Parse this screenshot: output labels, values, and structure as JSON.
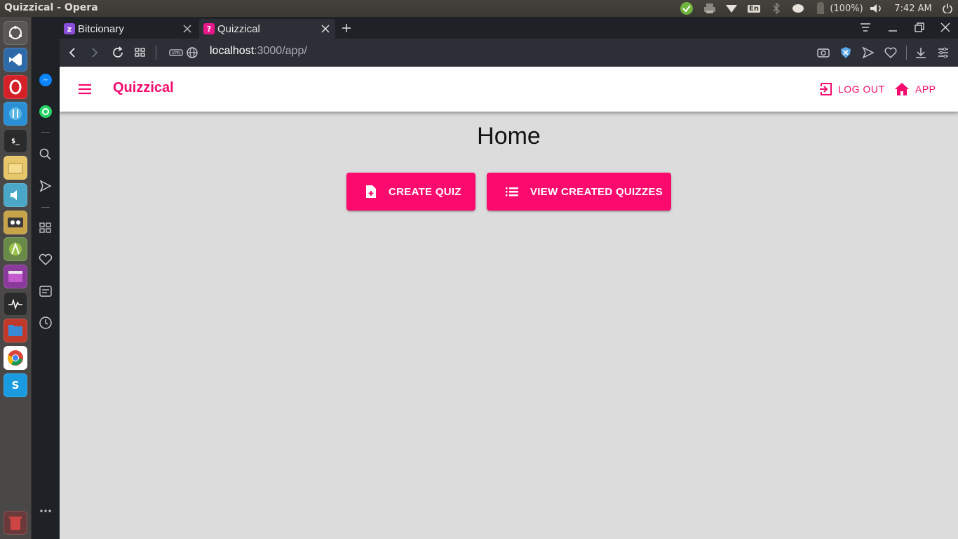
{
  "os": {
    "window_title": "Quizzical - Opera",
    "battery": "(100%)",
    "clock": "7:42 AM",
    "keyboard": "En"
  },
  "browser": {
    "tabs": [
      {
        "title": "Bitcionary",
        "favicon_color": "#8a4fd8",
        "favicon_text": "z"
      },
      {
        "title": "Quizzical",
        "favicon_color": "#e8178a",
        "favicon_text": "?"
      }
    ],
    "url": {
      "host": "localhost",
      "rest": ":3000/app/"
    },
    "accent": "#f50a6d"
  },
  "app": {
    "brand": "Quizzical",
    "nav": {
      "logout_label": "LOG OUT",
      "app_label": "APP"
    },
    "page_title": "Home",
    "buttons": {
      "create_quiz": "CREATE QUIZ",
      "view_created": "VIEW CREATED QUIZZES"
    }
  }
}
